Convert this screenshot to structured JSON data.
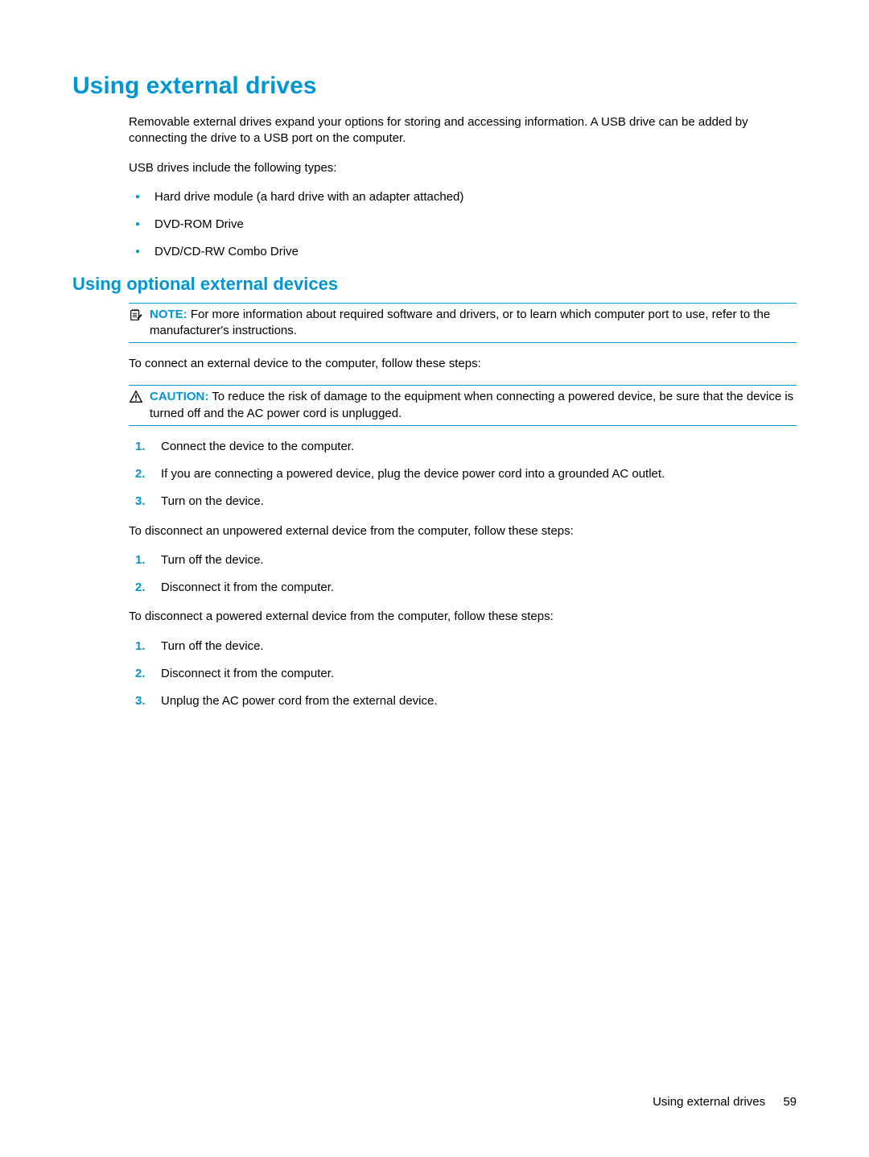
{
  "h1": "Using external drives",
  "intro": "Removable external drives expand your options for storing and accessing information. A USB drive can be added by connecting the drive to a USB port on the computer.",
  "usb_intro": "USB drives include the following types:",
  "usb_types": [
    "Hard drive module (a hard drive with an adapter attached)",
    "DVD-ROM Drive",
    "DVD/CD-RW Combo Drive"
  ],
  "h2": "Using optional external devices",
  "note_label": "NOTE:",
  "note_body": "For more information about required software and drivers, or to learn which computer port to use, refer to the manufacturer's instructions.",
  "connect_intro": "To connect an external device to the computer, follow these steps:",
  "caution_label": "CAUTION:",
  "caution_body": "To reduce the risk of damage to the equipment when connecting a powered device, be sure that the device is turned off and the AC power cord is unplugged.",
  "steps_connect": [
    "Connect the device to the computer.",
    "If you are connecting a powered device, plug the device power cord into a grounded AC outlet.",
    "Turn on the device."
  ],
  "disconnect_unpowered_intro": "To disconnect an unpowered external device from the computer, follow these steps:",
  "steps_disconnect_unpowered": [
    "Turn off the device.",
    "Disconnect it from the computer."
  ],
  "disconnect_powered_intro": "To disconnect a powered external device from the computer, follow these steps:",
  "steps_disconnect_powered": [
    "Turn off the device.",
    "Disconnect it from the computer.",
    "Unplug the AC power cord from the external device."
  ],
  "footer_text": "Using external drives",
  "footer_page": "59"
}
